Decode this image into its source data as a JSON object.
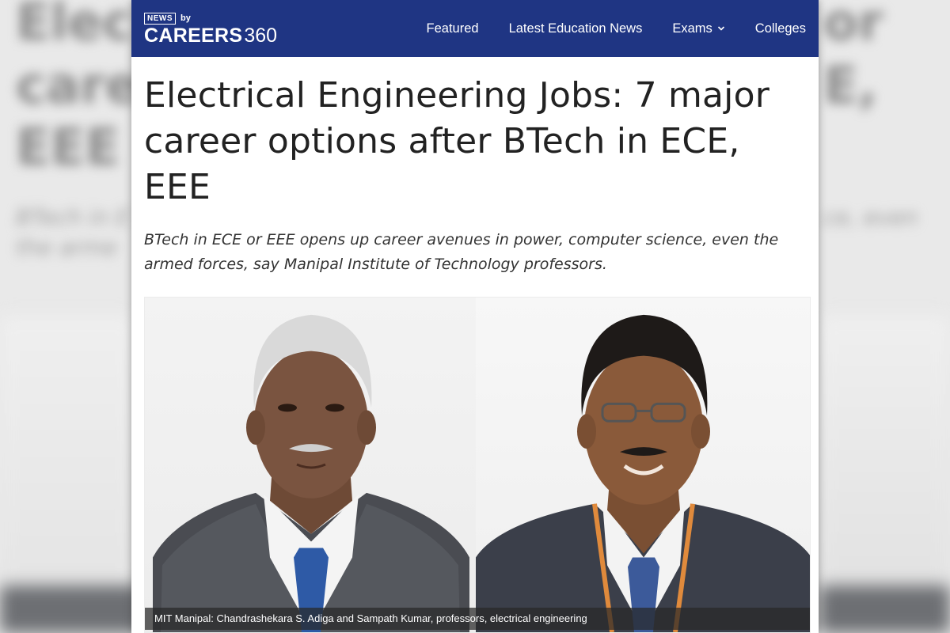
{
  "brand": {
    "badge": "NEWS",
    "by": "by",
    "name_bold": "CAREERS",
    "name_light": "360"
  },
  "nav": {
    "items": [
      {
        "label": "Featured"
      },
      {
        "label": "Latest Education News"
      },
      {
        "label": "Exams"
      },
      {
        "label": "Colleges"
      }
    ]
  },
  "article": {
    "headline": "Electrical Engineering Jobs: 7 major career options after BTech in ECE, EEE",
    "subheading": "BTech in ECE or EEE opens up career avenues in power, computer science, even the armed forces, say Manipal Institute of Technology professors.",
    "image_caption": "MIT Manipal: Chandrashekara S. Adiga and Sampath Kumar, professors, electrical engineering"
  },
  "colors": {
    "navbar": "#1f3583",
    "headline": "#222222",
    "caption_bg": "rgba(40,40,40,0.72)"
  },
  "icons": {
    "exams_dropdown": "chevron-down-icon"
  }
}
